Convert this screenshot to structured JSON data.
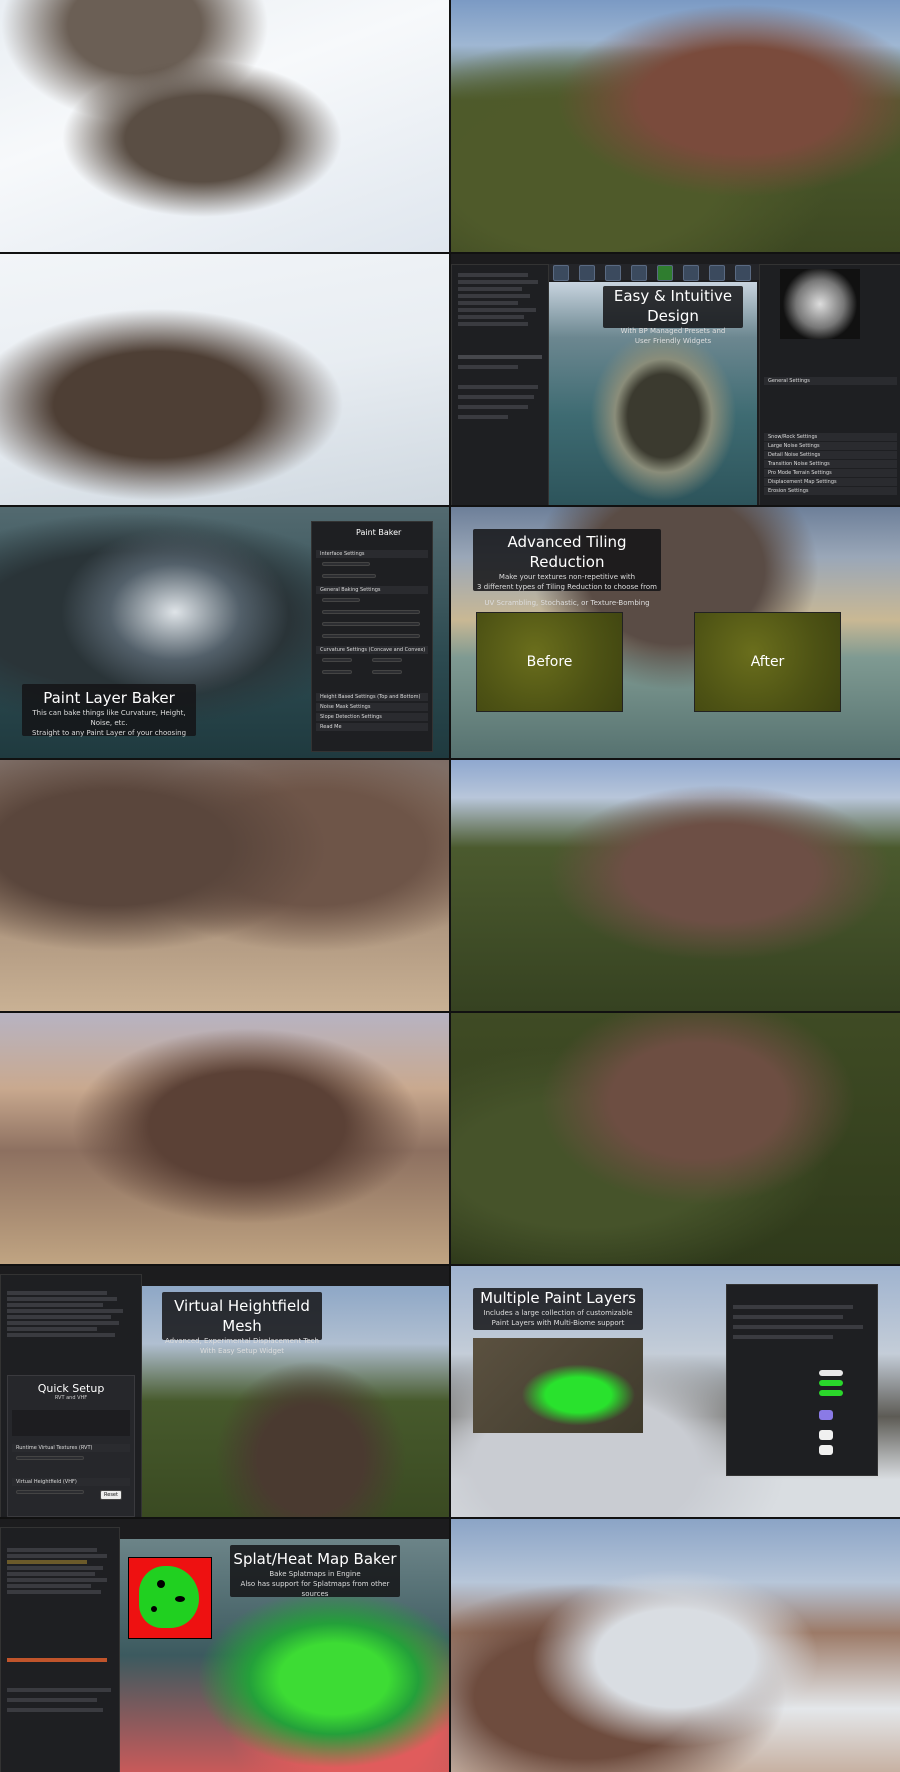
{
  "easy_design": {
    "title": "Easy & Intuitive Design",
    "subtitle_line1": "With BP Managed Presets and",
    "subtitle_line2": "User Friendly Widgets",
    "settings_sections": [
      "General Settings",
      "Snow/Rock Settings",
      "Large Noise Settings",
      "Detail Noise Settings",
      "Transition Noise Settings",
      "Pro Mode Terrain Settings",
      "Displacement Map Settings",
      "Erosion Settings"
    ]
  },
  "paint_baker": {
    "panel_title": "Paint Baker",
    "sections": [
      "Interface Settings",
      "General Baking Settings",
      "Curvature Settings (Concave and Convex)",
      "Height Based Settings (Top and Bottom)",
      "Noise Mask Settings",
      "Slope Detection Settings",
      "Read Me"
    ],
    "caption_title": "Paint Layer Baker",
    "caption_line1": "This can bake things like Curvature, Height, Noise, etc.",
    "caption_line2": "Straight to any Paint Layer of your choosing"
  },
  "tiling": {
    "title": "Advanced Tiling Reduction",
    "line1": "Make your textures non-repetitive with",
    "line2": "3 different types of Tiling Reduction to choose from",
    "line3": "UV Scrambling, Stochastic, or Texture-Bombing",
    "before_label": "Before",
    "after_label": "After"
  },
  "vhm": {
    "title": "Virtual Heightfield Mesh",
    "line1": "Advanced, Experimental Displacement Tech",
    "line2": "With Easy Setup Widget",
    "quick_setup_title": "Quick Setup",
    "quick_setup_sub": "RVT and VHF",
    "rvt_header": "Runtime Virtual Textures (RVT)",
    "vhf_header": "Virtual Heightfield (VHF)",
    "reset_label": "Reset"
  },
  "paint_layers": {
    "title": "Multiple Paint Layers",
    "line1": "Includes a large collection of customizable",
    "line2": "Paint Layers with Multi-Biome support"
  },
  "heatmap": {
    "title": "Splat/Heat Map Baker",
    "line1": "Bake Splatmaps in Engine",
    "line2": "Also has support for Splatmaps from other sources"
  },
  "colors": {
    "caption_bg": "#141416",
    "heat_red": "#e11111",
    "heat_green": "#20d020",
    "panel_dark": "#1e1f22"
  }
}
